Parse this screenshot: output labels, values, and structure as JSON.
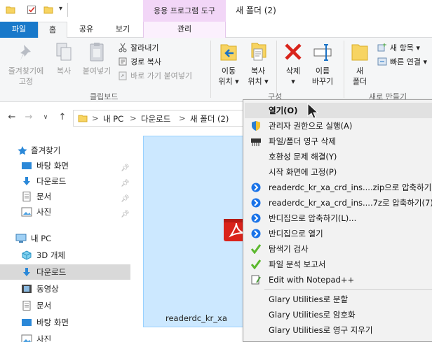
{
  "titlebar": {
    "tool_tab_heading": "응용 프로그램 도구",
    "window_title": "새 폴더 (2)"
  },
  "tabs": {
    "file": "파일",
    "home": "홈",
    "share": "공유",
    "view": "보기",
    "manage": "관리"
  },
  "ribbon": {
    "pin": "즐겨찾기에\n고정",
    "pin_l1": "즐겨찾기에",
    "pin_l2": "고정",
    "copy": "복사",
    "paste": "붙여넣기",
    "cut": "잘라내기",
    "copy_path": "경로 복사",
    "paste_shortcut": "바로 가기 붙여넣기",
    "clipboard_group": "클립보드",
    "move_l1": "이동",
    "move_l2": "위치 ▾",
    "copyto_l1": "복사",
    "copyto_l2": "위치 ▾",
    "delete_l1": "삭제",
    "delete_l2": "▾",
    "rename_l1": "이름",
    "rename_l2": "바꾸기",
    "organize_group": "구성",
    "newfolder_l1": "새",
    "newfolder_l2": "폴더",
    "new_item": "새 항목 ▾",
    "easy_access": "빠른 연결 ▾",
    "new_group": "새로 만들기"
  },
  "navbar": {
    "crumbs": [
      "내 PC",
      "다운로드",
      "새 폴더 (2)"
    ],
    "sep": ">"
  },
  "sidebar": {
    "items": [
      {
        "label": "즐겨찾기"
      },
      {
        "label": "바탕 화면"
      },
      {
        "label": "다운로드"
      },
      {
        "label": "문서"
      },
      {
        "label": "사진"
      },
      {
        "label": "내 PC"
      },
      {
        "label": "3D 개체"
      },
      {
        "label": "다운로드"
      },
      {
        "label": "동영상"
      },
      {
        "label": "문서"
      },
      {
        "label": "바탕 화면"
      },
      {
        "label": "사진"
      }
    ]
  },
  "content": {
    "file_name": "readerdc_kr_xa"
  },
  "context_menu": {
    "items": [
      {
        "label": "열기(O)"
      },
      {
        "label": "관리자 권한으로 실행(A)"
      },
      {
        "label": "파일/폴더 영구 삭제"
      },
      {
        "label": "호환성 문제 해결(Y)"
      },
      {
        "label": "시작 화면에 고정(P)"
      },
      {
        "label": "readerdc_kr_xa_crd_ins....zip으로 압축하기(C)"
      },
      {
        "label": "readerdc_kr_xa_crd_ins....7z로 압축하기(7)"
      },
      {
        "label": "반디집으로 압축하기(L)..."
      },
      {
        "label": "반디집으로 열기"
      },
      {
        "label": "탐색기 검사"
      },
      {
        "label": "파일 분석 보고서"
      },
      {
        "label": "Edit with Notepad++"
      },
      {
        "label": "Glary Utilities로 분할"
      },
      {
        "label": "Glary Utilities로 암호화"
      },
      {
        "label": "Glary Utilities로 영구 지우기"
      }
    ]
  },
  "colors": {
    "file_tab": "#1979ca",
    "selection": "#cce8ff",
    "tool_tab": "#f2d6f7",
    "delete_red": "#d9241b",
    "folder_yellow": "#f7d462",
    "acrobat_red": "#d9231b"
  }
}
